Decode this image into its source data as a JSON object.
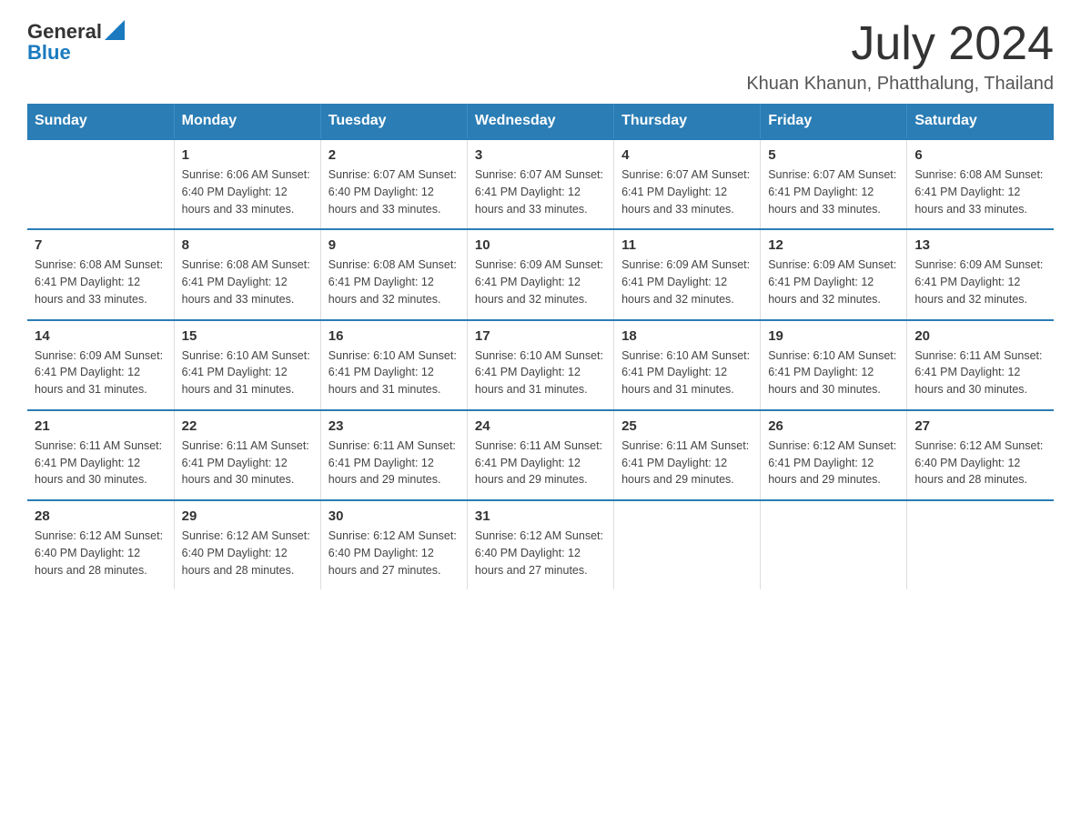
{
  "logo": {
    "text_general": "General",
    "text_blue": "Blue",
    "aria": "GeneralBlue logo"
  },
  "title": {
    "month_year": "July 2024",
    "location": "Khuan Khanun, Phatthalung, Thailand"
  },
  "days_of_week": [
    "Sunday",
    "Monday",
    "Tuesday",
    "Wednesday",
    "Thursday",
    "Friday",
    "Saturday"
  ],
  "weeks": [
    [
      {
        "day": "",
        "info": ""
      },
      {
        "day": "1",
        "info": "Sunrise: 6:06 AM\nSunset: 6:40 PM\nDaylight: 12 hours\nand 33 minutes."
      },
      {
        "day": "2",
        "info": "Sunrise: 6:07 AM\nSunset: 6:40 PM\nDaylight: 12 hours\nand 33 minutes."
      },
      {
        "day": "3",
        "info": "Sunrise: 6:07 AM\nSunset: 6:41 PM\nDaylight: 12 hours\nand 33 minutes."
      },
      {
        "day": "4",
        "info": "Sunrise: 6:07 AM\nSunset: 6:41 PM\nDaylight: 12 hours\nand 33 minutes."
      },
      {
        "day": "5",
        "info": "Sunrise: 6:07 AM\nSunset: 6:41 PM\nDaylight: 12 hours\nand 33 minutes."
      },
      {
        "day": "6",
        "info": "Sunrise: 6:08 AM\nSunset: 6:41 PM\nDaylight: 12 hours\nand 33 minutes."
      }
    ],
    [
      {
        "day": "7",
        "info": "Sunrise: 6:08 AM\nSunset: 6:41 PM\nDaylight: 12 hours\nand 33 minutes."
      },
      {
        "day": "8",
        "info": "Sunrise: 6:08 AM\nSunset: 6:41 PM\nDaylight: 12 hours\nand 33 minutes."
      },
      {
        "day": "9",
        "info": "Sunrise: 6:08 AM\nSunset: 6:41 PM\nDaylight: 12 hours\nand 32 minutes."
      },
      {
        "day": "10",
        "info": "Sunrise: 6:09 AM\nSunset: 6:41 PM\nDaylight: 12 hours\nand 32 minutes."
      },
      {
        "day": "11",
        "info": "Sunrise: 6:09 AM\nSunset: 6:41 PM\nDaylight: 12 hours\nand 32 minutes."
      },
      {
        "day": "12",
        "info": "Sunrise: 6:09 AM\nSunset: 6:41 PM\nDaylight: 12 hours\nand 32 minutes."
      },
      {
        "day": "13",
        "info": "Sunrise: 6:09 AM\nSunset: 6:41 PM\nDaylight: 12 hours\nand 32 minutes."
      }
    ],
    [
      {
        "day": "14",
        "info": "Sunrise: 6:09 AM\nSunset: 6:41 PM\nDaylight: 12 hours\nand 31 minutes."
      },
      {
        "day": "15",
        "info": "Sunrise: 6:10 AM\nSunset: 6:41 PM\nDaylight: 12 hours\nand 31 minutes."
      },
      {
        "day": "16",
        "info": "Sunrise: 6:10 AM\nSunset: 6:41 PM\nDaylight: 12 hours\nand 31 minutes."
      },
      {
        "day": "17",
        "info": "Sunrise: 6:10 AM\nSunset: 6:41 PM\nDaylight: 12 hours\nand 31 minutes."
      },
      {
        "day": "18",
        "info": "Sunrise: 6:10 AM\nSunset: 6:41 PM\nDaylight: 12 hours\nand 31 minutes."
      },
      {
        "day": "19",
        "info": "Sunrise: 6:10 AM\nSunset: 6:41 PM\nDaylight: 12 hours\nand 30 minutes."
      },
      {
        "day": "20",
        "info": "Sunrise: 6:11 AM\nSunset: 6:41 PM\nDaylight: 12 hours\nand 30 minutes."
      }
    ],
    [
      {
        "day": "21",
        "info": "Sunrise: 6:11 AM\nSunset: 6:41 PM\nDaylight: 12 hours\nand 30 minutes."
      },
      {
        "day": "22",
        "info": "Sunrise: 6:11 AM\nSunset: 6:41 PM\nDaylight: 12 hours\nand 30 minutes."
      },
      {
        "day": "23",
        "info": "Sunrise: 6:11 AM\nSunset: 6:41 PM\nDaylight: 12 hours\nand 29 minutes."
      },
      {
        "day": "24",
        "info": "Sunrise: 6:11 AM\nSunset: 6:41 PM\nDaylight: 12 hours\nand 29 minutes."
      },
      {
        "day": "25",
        "info": "Sunrise: 6:11 AM\nSunset: 6:41 PM\nDaylight: 12 hours\nand 29 minutes."
      },
      {
        "day": "26",
        "info": "Sunrise: 6:12 AM\nSunset: 6:41 PM\nDaylight: 12 hours\nand 29 minutes."
      },
      {
        "day": "27",
        "info": "Sunrise: 6:12 AM\nSunset: 6:40 PM\nDaylight: 12 hours\nand 28 minutes."
      }
    ],
    [
      {
        "day": "28",
        "info": "Sunrise: 6:12 AM\nSunset: 6:40 PM\nDaylight: 12 hours\nand 28 minutes."
      },
      {
        "day": "29",
        "info": "Sunrise: 6:12 AM\nSunset: 6:40 PM\nDaylight: 12 hours\nand 28 minutes."
      },
      {
        "day": "30",
        "info": "Sunrise: 6:12 AM\nSunset: 6:40 PM\nDaylight: 12 hours\nand 27 minutes."
      },
      {
        "day": "31",
        "info": "Sunrise: 6:12 AM\nSunset: 6:40 PM\nDaylight: 12 hours\nand 27 minutes."
      },
      {
        "day": "",
        "info": ""
      },
      {
        "day": "",
        "info": ""
      },
      {
        "day": "",
        "info": ""
      }
    ]
  ]
}
